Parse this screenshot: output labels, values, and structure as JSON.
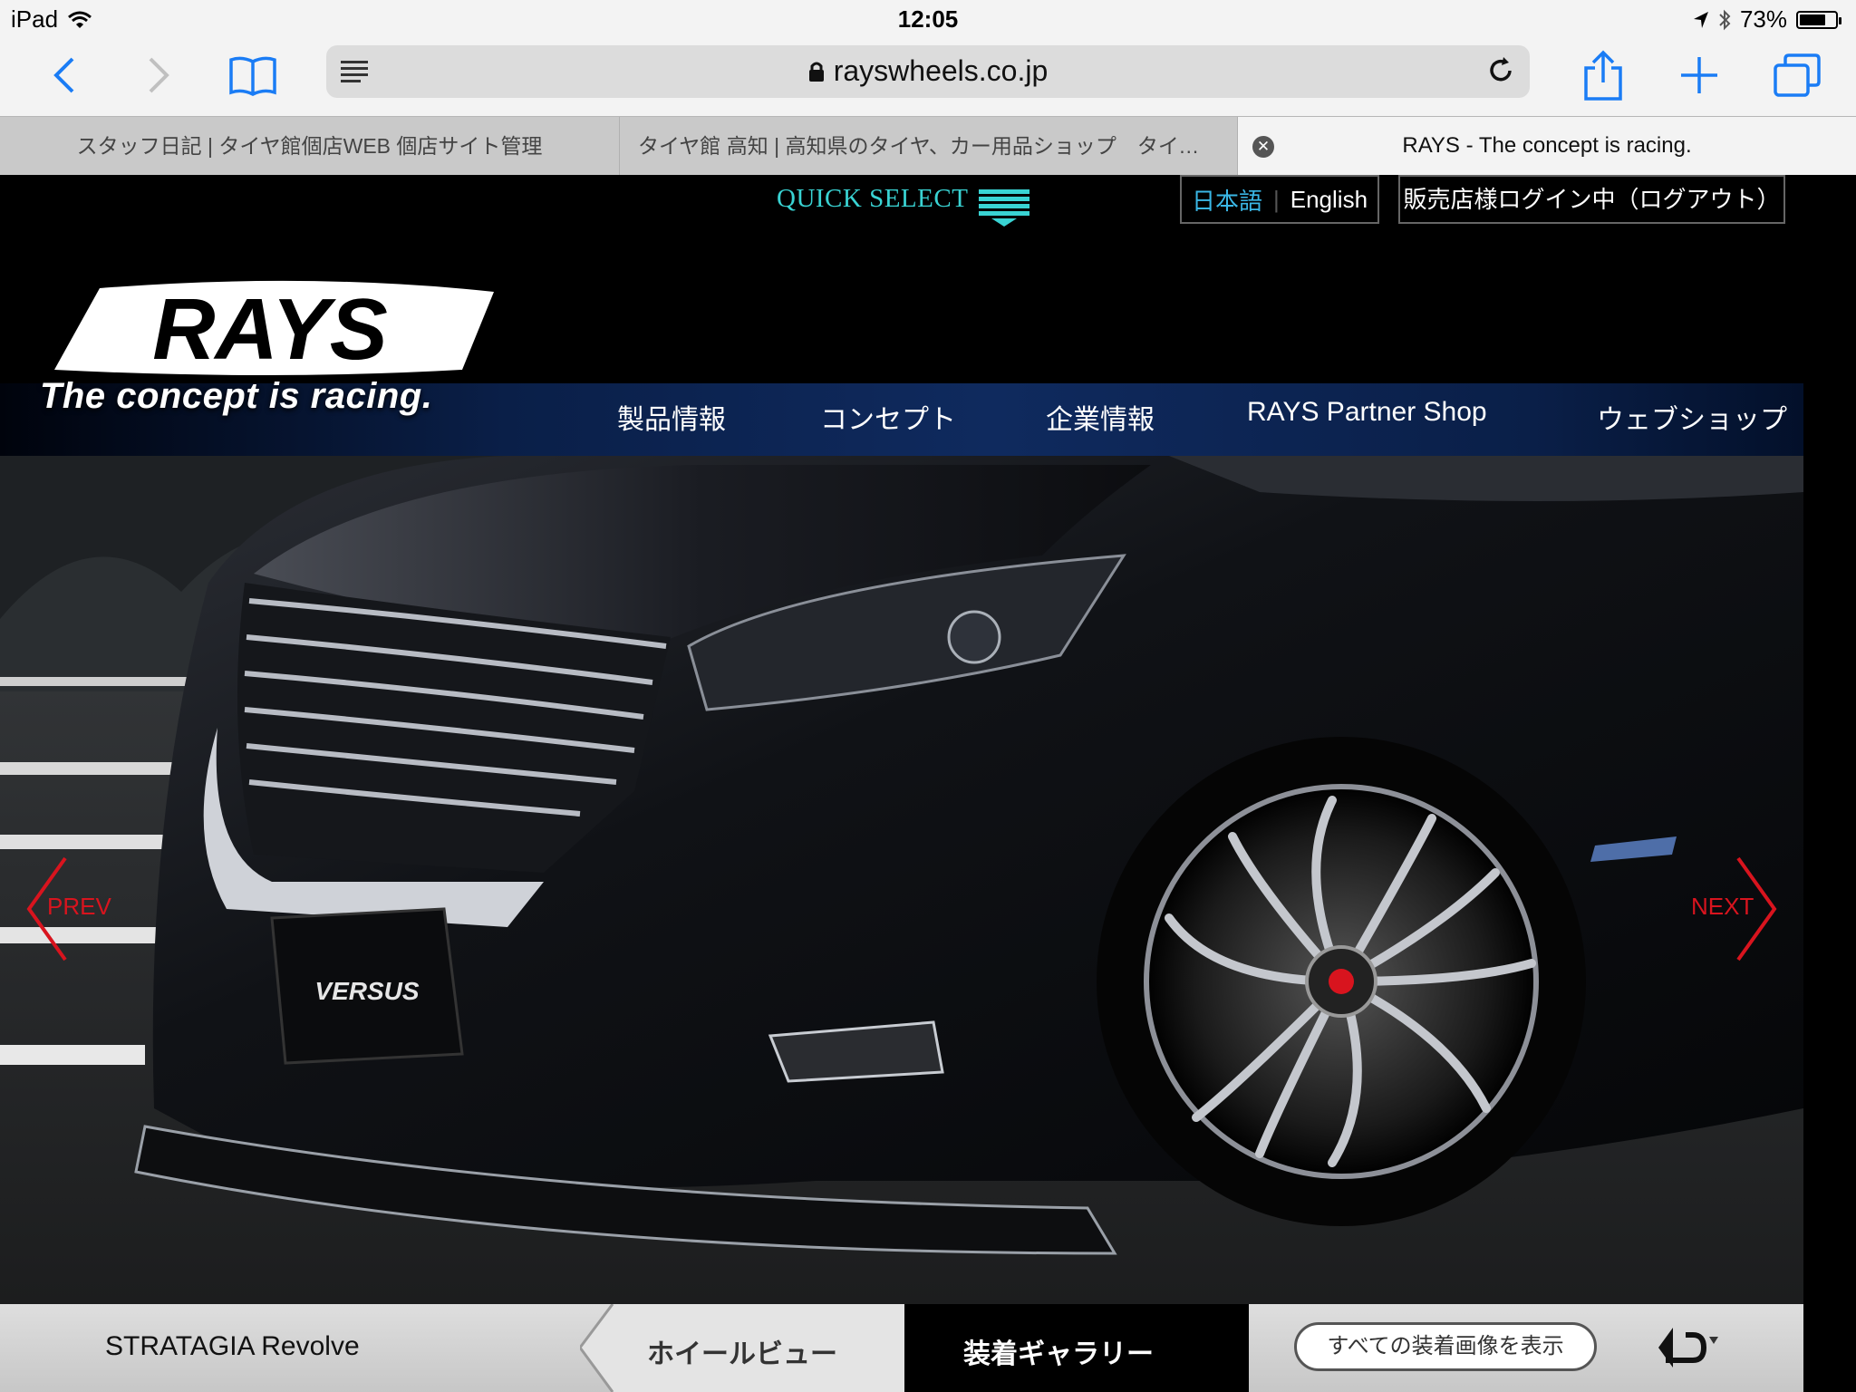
{
  "status_bar": {
    "device": "iPad",
    "time": "12:05",
    "battery": "73%",
    "battery_level": 0.73
  },
  "browser": {
    "url": "rayswheels.co.jp",
    "tabs": [
      {
        "title": "スタッフ日記 | タイヤ館個店WEB 個店サイト管理"
      },
      {
        "title": "タイヤ館 高知 | 高知県のタイヤ、カー用品ショップ　タイヤ…"
      },
      {
        "title": "RAYS - The concept is racing.",
        "active": true
      }
    ]
  },
  "page": {
    "quick_select": "QUICK SELECT",
    "language": {
      "ja": "日本語",
      "en": "English"
    },
    "login": "販売店様ログイン中（ログアウト）",
    "brand": {
      "logo": "RAYS",
      "tagline": "The concept is racing."
    },
    "nav": [
      "製品情報",
      "コンセプト",
      "企業情報",
      "RAYS Partner Shop",
      "ウェブショップ"
    ],
    "carousel": {
      "prev": "PREV",
      "next": "NEXT",
      "plate_brand": "VERSUS"
    },
    "bottom": {
      "product": "STRATAGIA Revolve",
      "wheel_view": "ホイールビュー",
      "gallery": "装着ギャラリー",
      "show_all": "すべての装着画像を表示"
    }
  },
  "colors": {
    "accent_cyan": "#39d3d3",
    "lang_active": "#3ab7e6",
    "carousel_arrow": "#d8141e",
    "nav_band": "#0f2a5e"
  }
}
